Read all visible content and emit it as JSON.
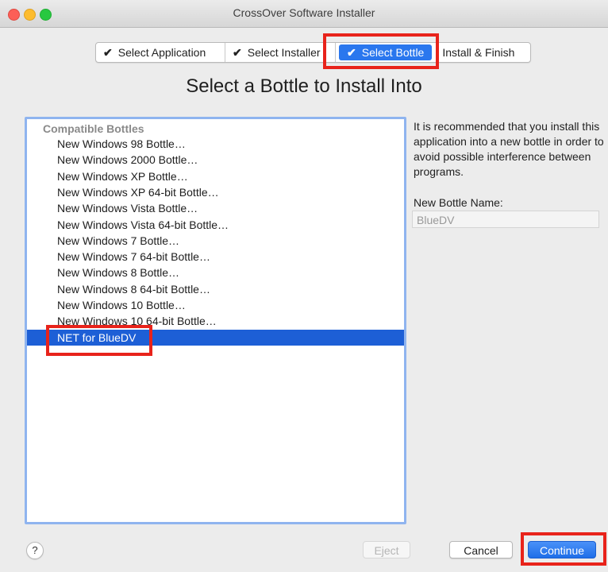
{
  "window": {
    "title": "CrossOver Software Installer"
  },
  "steps": [
    {
      "label": "Select Application",
      "checked": true,
      "active": false
    },
    {
      "label": "Select Installer",
      "checked": true,
      "active": false
    },
    {
      "label": "Select Bottle",
      "checked": true,
      "active": true
    },
    {
      "label": "Install & Finish",
      "checked": false,
      "active": false
    }
  ],
  "check_glyph": "✔",
  "heading": "Select a Bottle to Install Into",
  "bottle_list": {
    "header": "Compatible Bottles",
    "items": [
      "New Windows 98 Bottle…",
      "New Windows 2000 Bottle…",
      "New Windows XP Bottle…",
      "New Windows XP 64-bit Bottle…",
      "New Windows Vista Bottle…",
      "New Windows Vista 64-bit Bottle…",
      "New Windows 7 Bottle…",
      "New Windows 7 64-bit Bottle…",
      "New Windows 8 Bottle…",
      "New Windows 8 64-bit Bottle…",
      "New Windows 10 Bottle…",
      "New Windows 10 64-bit Bottle…",
      "NET for BlueDV"
    ],
    "selected_index": 12
  },
  "info_text": "It is recommended that you install this application into a new bottle in order to avoid possible interference between programs.",
  "new_bottle": {
    "label": "New Bottle Name:",
    "value": "BlueDV"
  },
  "buttons": {
    "help": "?",
    "eject": "Eject",
    "cancel": "Cancel",
    "continue": "Continue"
  },
  "colors": {
    "highlight": "#e8231b",
    "accent": "#1d5fd6",
    "list_border": "#8fb4ef"
  }
}
